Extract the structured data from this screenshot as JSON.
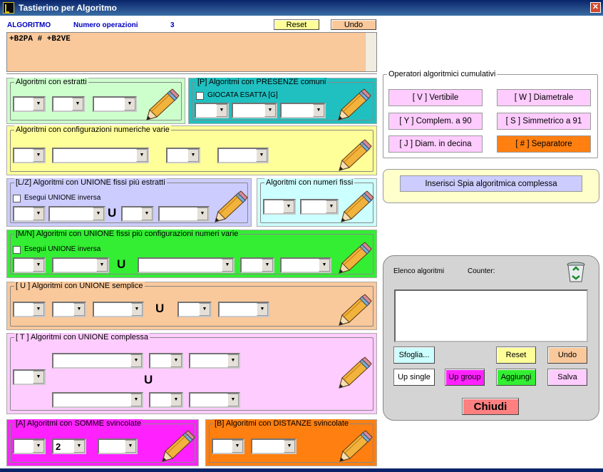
{
  "window": {
    "title": "Tastierino per Algoritmo"
  },
  "header": {
    "algoritmo_label": "ALGORITMO",
    "numero_label": "Numero operazioni",
    "numero_value": "3",
    "reset": "Reset",
    "undo": "Undo"
  },
  "formula": {
    "value": "+B2PA # +B2VE"
  },
  "groups": {
    "estratti": "Algoritmi con estratti",
    "presenze": "[P] Algoritmi con PRESENZE comuni",
    "presenze_chk": "GIOCATA ESATTA  [G]",
    "config": "Algoritmi con configurazioni numeriche varie",
    "unione_estratti": "[L/Z] Algoritmi con UNIONE fissi più estratti",
    "unione_inversa": "Esegui UNIONE inversa",
    "numeri_fissi": "Algoritmi con numeri fissi",
    "unione_config": "[M/N] Algoritmi con UNIONE fissi più configurazioni numeri varie",
    "unione_inversa2": "Esegui UNIONE inversa",
    "unione_semplice": "[ U ] Algoritmi con UNIONE semplice",
    "unione_complessa": "[ T ] Algoritmi con UNIONE complessa",
    "somme": "[A] Algoritmi con SOMME svincolate",
    "distanze": "[B] Algoritmi con DISTANZE svincolate",
    "u": "U",
    "somme_value": "2"
  },
  "operators": {
    "title": "Operatori algoritmici cumulativi",
    "items": [
      "[ V ] Vertibile",
      "[ W ] Diametrale",
      "[ Y ] Complem. a 90",
      "[ S ] Simmetrico  a 91",
      "[ J ] Diam. in decina",
      "[ # ] Separatore"
    ]
  },
  "spia": {
    "label": "Inserisci Spia algoritmica complessa"
  },
  "elenco": {
    "title": "Elenco algoritmi",
    "counter": "Counter:",
    "sfoglia": "Sfoglia...",
    "reset": "Reset",
    "undo": "Undo",
    "up_single": "Up single",
    "up_group": "Up group",
    "aggiungi": "Aggiungi",
    "salva": "Salva",
    "chiudi": "Chiudi"
  }
}
